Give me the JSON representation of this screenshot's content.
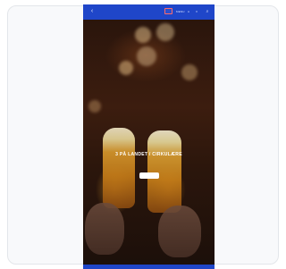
{
  "colors": {
    "header_blue": "#1f46c9",
    "card_border": "#e3e6ea",
    "button_bg": "#ffffff"
  },
  "header": {
    "back_icon": "chevron-left-icon",
    "logo_icon": "brand-logo-icon",
    "links": [
      "MENU",
      "A",
      "V"
    ],
    "search_icon": "search-icon"
  },
  "hero": {
    "headline": "3 PÅ LANDET / CIRKULÆRE",
    "subline": "",
    "cta_label": ""
  }
}
